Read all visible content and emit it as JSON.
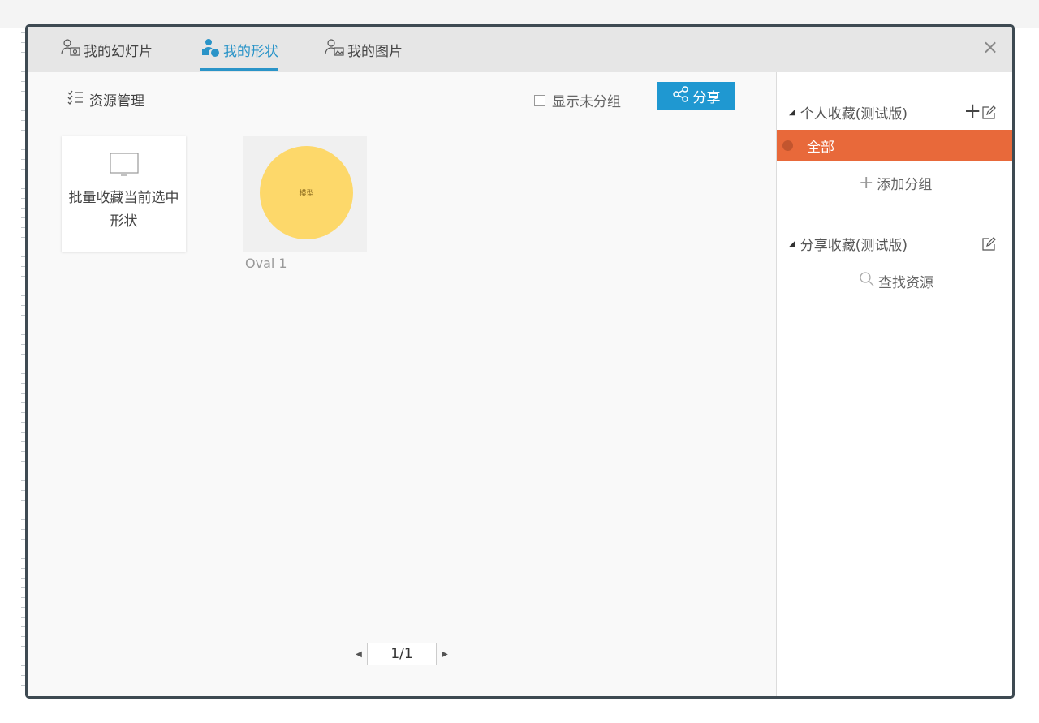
{
  "tabs": [
    {
      "label": "我的幻灯片",
      "icon": "slides-user-icon",
      "active": false
    },
    {
      "label": "我的形状",
      "icon": "shapes-user-icon",
      "active": true
    },
    {
      "label": "我的图片",
      "icon": "images-user-icon",
      "active": false
    }
  ],
  "toolbar": {
    "resource_mgmt": "资源管理",
    "show_ungrouped": "显示未分组",
    "share": "分享"
  },
  "cards": {
    "batch_line1": "批量收藏当前选中",
    "batch_line2": "形状",
    "shape_text": "模型",
    "shape_name": "Oval 1"
  },
  "pager": {
    "page": "1/1"
  },
  "sidebar": {
    "personal_section": "个人收藏(测试版)",
    "all": "全部",
    "add_group": "添加分组",
    "shared_section": "分享收藏(测试版)",
    "find_resource": "查找资源"
  },
  "colors": {
    "accent_blue": "#1f98d1",
    "active_tab": "#2a94c8",
    "selected_orange": "#e8693a",
    "oval_fill": "#fdd86a"
  }
}
